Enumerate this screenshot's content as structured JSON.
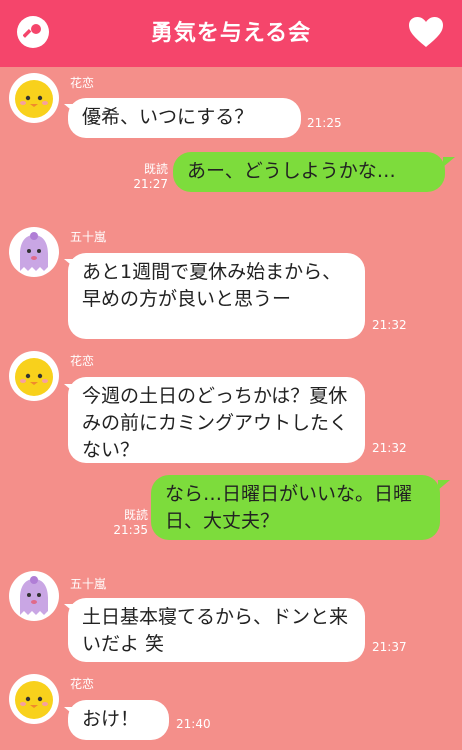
{
  "header": {
    "title": "勇気を与える会",
    "left_icon": "key-icon",
    "right_icon": "heart-icon"
  },
  "colors": {
    "header": "#f5456b",
    "background": "#f48f8a",
    "outgoing": "#7ddc3c",
    "incoming": "#ffffff"
  },
  "messages": [
    {
      "sender": "花恋",
      "text": "優希、いつにする？",
      "time": "21:25"
    },
    {
      "status": "既読",
      "text": "あー、どうしようかな…",
      "time": "21:27"
    },
    {
      "sender": "五十嵐",
      "text": "あと1週間で夏休み始まから、早めの方が良いと思うー",
      "time": "21:32"
    },
    {
      "sender": "花恋",
      "text": "今週の土日のどっちかは？夏休みの前にカミングアウトしたくない？",
      "time": "21:32"
    },
    {
      "status": "既読",
      "text": "なら…日曜日がいいな。日曜日、大丈夫？",
      "time": "21:35"
    },
    {
      "sender": "五十嵐",
      "text": "土日基本寝てるから、ドンと来いだよ 笑",
      "time": "21:37"
    },
    {
      "sender": "花恋",
      "text": "おけ！",
      "time": "21:40"
    }
  ]
}
